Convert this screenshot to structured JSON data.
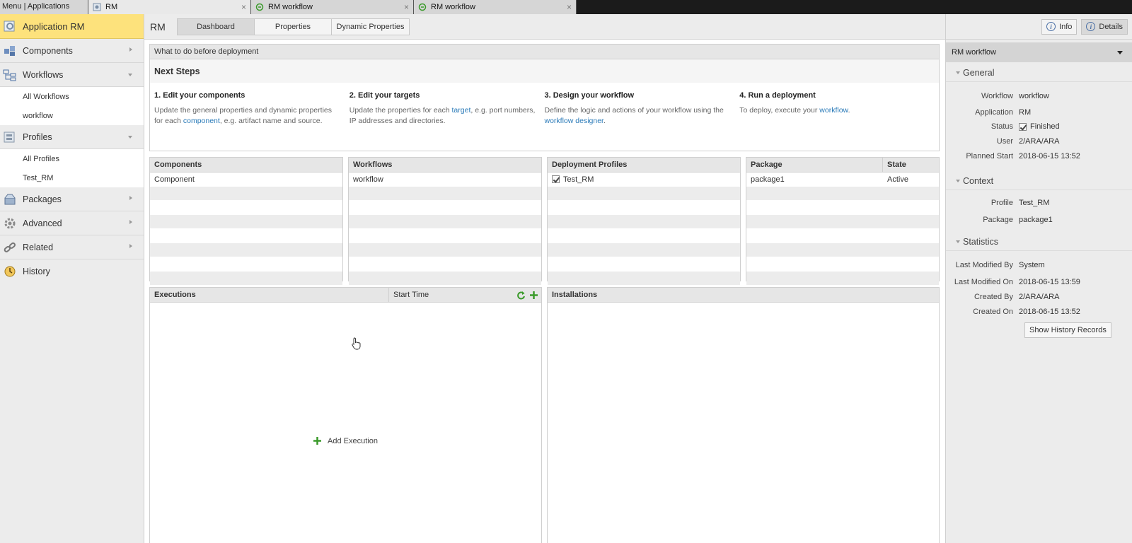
{
  "topbar": {
    "menu_label": "Menu | Applications",
    "tabs": [
      {
        "label": "RM",
        "close": "×"
      },
      {
        "label": "RM workflow",
        "close": "×"
      },
      {
        "label": "RM workflow",
        "close": "×"
      }
    ]
  },
  "sidebar": {
    "header": "Application RM",
    "items": [
      {
        "label": "Components"
      },
      {
        "label": "Workflows",
        "children": [
          "All Workflows",
          "workflow"
        ]
      },
      {
        "label": "Profiles",
        "children": [
          "All Profiles",
          "Test_RM"
        ]
      },
      {
        "label": "Packages"
      },
      {
        "label": "Advanced"
      },
      {
        "label": "Related"
      },
      {
        "label": "History"
      }
    ]
  },
  "main": {
    "title": "RM",
    "tabs": [
      "Dashboard",
      "Properties",
      "Dynamic Properties"
    ],
    "active_tab": "Dashboard",
    "before_deployment": {
      "header": "What to do before deployment",
      "title": "Next Steps",
      "steps": [
        {
          "title": "1. Edit your components",
          "pre": "Update the general properties and dynamic properties for each ",
          "link": "component",
          "post": ", e.g. artifact name and source.",
          "link2": "",
          "post2": ""
        },
        {
          "title": "2. Edit your targets",
          "pre": "Update the properties for each ",
          "link": "target",
          "post": ", e.g. port numbers, IP addresses and directories.",
          "link2": "",
          "post2": ""
        },
        {
          "title": "3. Design your workflow",
          "pre": "Define the logic and actions of your workflow using the ",
          "link": "workflow designer",
          "post": ".",
          "link2": "",
          "post2": ""
        },
        {
          "title": "4. Run a deployment",
          "pre": "To deploy, execute your ",
          "link": "workflow",
          "post": ".",
          "link2": "",
          "post2": ""
        }
      ]
    },
    "components": {
      "header": "Components",
      "rows": [
        "Component"
      ]
    },
    "workflows": {
      "header": "Workflows",
      "rows": [
        "workflow"
      ]
    },
    "deployment_profiles": {
      "header": "Deployment Profiles",
      "rows": [
        "Test_RM"
      ]
    },
    "packages": {
      "headers": [
        "Package",
        "State"
      ],
      "rows": [
        [
          "package1",
          "Active"
        ]
      ]
    },
    "executions": {
      "header": "Executions",
      "col2": "Start Time",
      "add_label": "Add Execution"
    },
    "installations": {
      "header": "Installations"
    }
  },
  "rightpanel": {
    "info_label": "Info",
    "details_label": "Details",
    "title": "RM workflow",
    "general": {
      "header": "General",
      "workflow_k": "Workflow",
      "workflow_v": "workflow",
      "application_k": "Application",
      "application_v": "RM",
      "status_k": "Status",
      "status_v": "Finished",
      "user_k": "User",
      "user_v": "2/ARA/ARA",
      "planned_k": "Planned Start",
      "planned_v": "2018-06-15 13:52"
    },
    "context": {
      "header": "Context",
      "profile_k": "Profile",
      "profile_v": "Test_RM",
      "package_k": "Package",
      "package_v": "package1"
    },
    "statistics": {
      "header": "Statistics",
      "lmb_k": "Last Modified By",
      "lmb_v": "System",
      "lmo_k": "Last Modified On",
      "lmo_v": "2018-06-15 13:59",
      "cb_k": "Created By",
      "cb_v": "2/ARA/ARA",
      "co_k": "Created On",
      "co_v": "2018-06-15 13:52",
      "history_button": "Show History Records"
    }
  },
  "colors": {
    "accent": "#fde27c",
    "link": "#2a7ab8",
    "add_green": "#3a9a2a"
  }
}
